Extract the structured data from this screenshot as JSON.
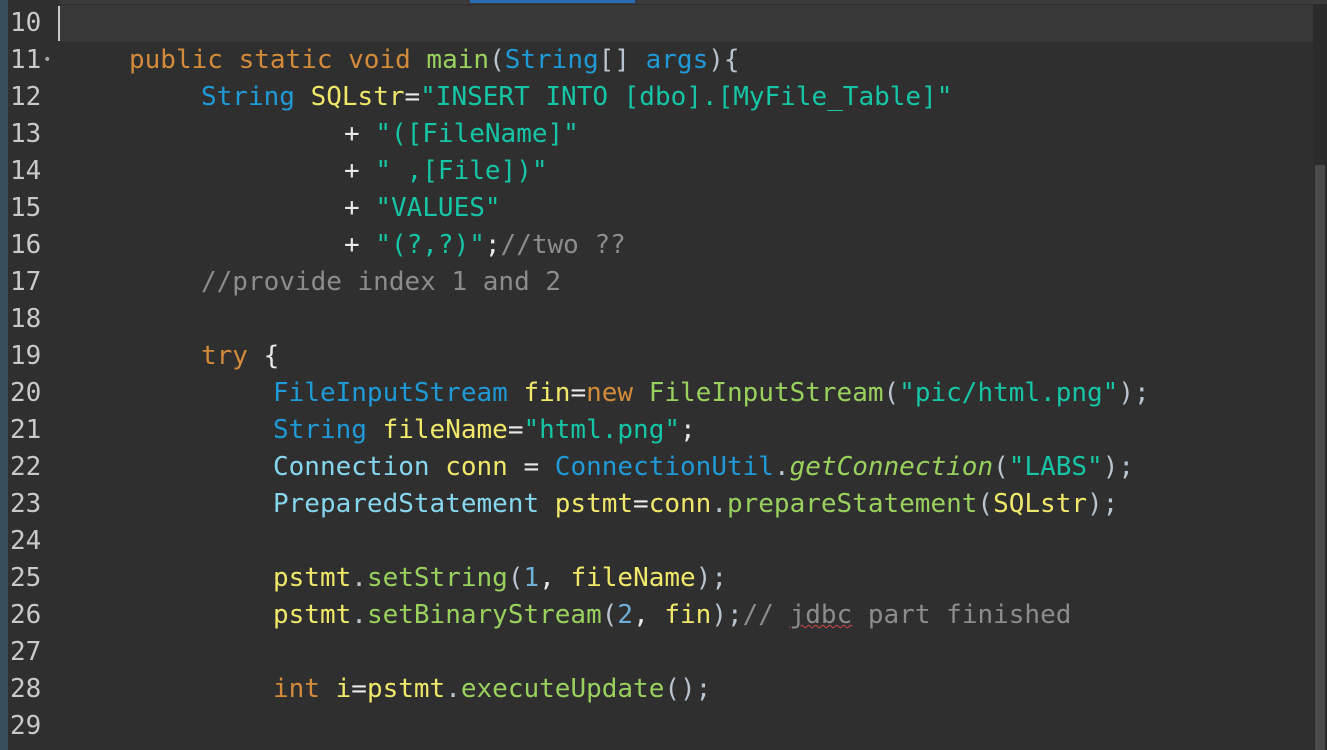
{
  "editor": {
    "line_numbers": [
      "10",
      "11",
      "12",
      "13",
      "14",
      "15",
      "16",
      "17",
      "18",
      "19",
      "20",
      "21",
      "22",
      "23",
      "24",
      "25",
      "26",
      "27",
      "28",
      "29"
    ],
    "fold_marker": "•",
    "l11": {
      "public": "public",
      "static": " static",
      "void": " void",
      "main": " main",
      "paren_open": "(",
      "string_type": "String",
      "brackets": "[] ",
      "args": "args",
      "close": "){"
    },
    "l12": {
      "type": "String",
      "var": " SQLstr",
      "eq": "=",
      "str": "\"INSERT INTO [dbo].[MyFile_Table]\""
    },
    "l13": {
      "plus": "+ ",
      "str": "\"([FileName]\""
    },
    "l14": {
      "plus": "+ ",
      "str": "\" ,[File])\""
    },
    "l15": {
      "plus": "+ ",
      "str": "\"VALUES\""
    },
    "l16": {
      "plus": "+ ",
      "str": "\"(?,?)\"",
      "semi": ";",
      "cmt": "//two ??"
    },
    "l17": {
      "cmt": "//provide index 1 and 2"
    },
    "l19": {
      "kw": "try",
      "brace": " {"
    },
    "l20": {
      "type": "FileInputStream",
      "var": " fin",
      "eq": "=",
      "kw": "new",
      "type2": " FileInputStream",
      "p_open": "(",
      "str": "\"pic/html.png\"",
      "p_close": ");"
    },
    "l21": {
      "type": "String",
      "var": " fileName",
      "eq": "=",
      "str": "\"html.png\"",
      "semi": ";"
    },
    "l22": {
      "cls": "Connection",
      "var": " conn",
      "eq": " = ",
      "type": "ConnectionUtil",
      "dot": ".",
      "method": "getConnection",
      "p_open": "(",
      "str": "\"LABS\"",
      "p_close": ");"
    },
    "l23": {
      "cls": "PreparedStatement",
      "var": " pstmt",
      "eq": "=",
      "conn": "conn",
      "dot": ".",
      "method": "prepareStatement",
      "p_open": "(",
      "arg": "SQLstr",
      "p_close": ");"
    },
    "l25": {
      "obj": "pstmt",
      "dot": ".",
      "method": "setString",
      "p_open": "(",
      "num": "1",
      "comma": ", ",
      "arg": "fileName",
      "p_close": ");"
    },
    "l26": {
      "obj": "pstmt",
      "dot": ".",
      "method": "setBinaryStream",
      "p_open": "(",
      "num": "2",
      "comma": ", ",
      "arg": "fin",
      "p_close": ");",
      "cmt1": "// ",
      "cmt_jdbc": "jdbc",
      "cmt2": " part finished"
    },
    "l28": {
      "kw": "int",
      "var": " i",
      "eq": "=",
      "obj": "pstmt",
      "dot": ".",
      "method": "executeUpdate",
      "close": "();"
    }
  },
  "colors": {
    "background": "#2f2f2f",
    "keyword": "#d28b3a",
    "type": "#1f9ad6",
    "string": "#15c5a5",
    "variable": "#f0e86a",
    "method": "#9ad15e",
    "comment": "#8c8c8c",
    "number": "#6fb0db"
  }
}
